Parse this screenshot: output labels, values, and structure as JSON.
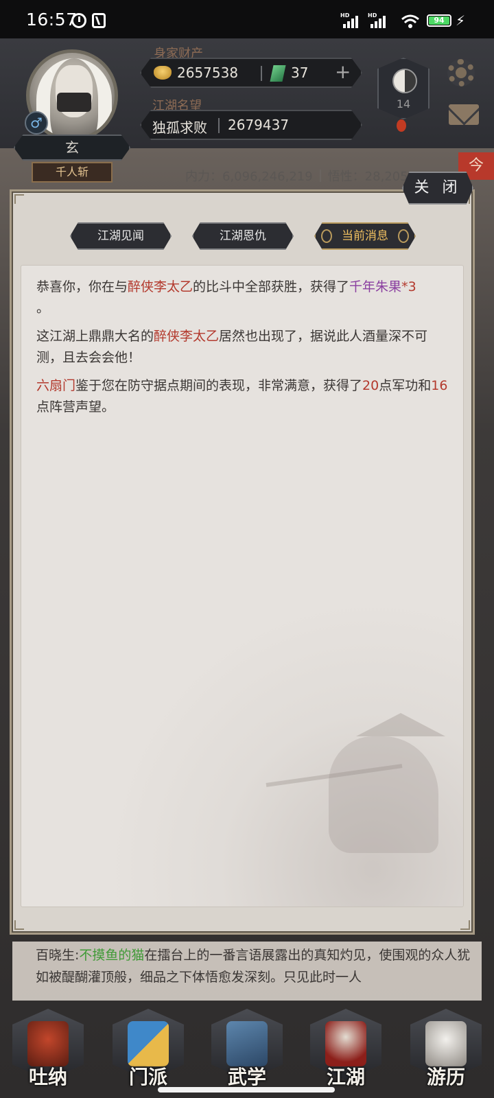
{
  "status_bar": {
    "time": "16:57",
    "hd1": "HD",
    "hd2": "HD",
    "battery": "94"
  },
  "header": {
    "wealth_label": "身家财产",
    "gold": "2657538",
    "jade": "37",
    "plus": "+",
    "fame_label": "江湖名望",
    "fame_title": "独孤求败",
    "fame_value": "2679437",
    "taiji_level": "14",
    "player_name": "玄",
    "player_title": "千人斩",
    "gender": "♂",
    "neili": "内力：6,096,246,219",
    "wuxing": "悟性：28,205,073",
    "red_tab": "今"
  },
  "modal": {
    "close_label": "关 闭",
    "tabs": [
      {
        "label": "江湖见闻"
      },
      {
        "label": "江湖恩仇"
      },
      {
        "label": "当前消息"
      }
    ],
    "active_tab": 2,
    "messages": {
      "m1": {
        "a": "恭喜你，你在与",
        "b": "醉侠李太乙",
        "c": "的比斗中全部获胜，获得了",
        "d": "千年朱果",
        "e": "*3",
        "f": "。"
      },
      "m2": {
        "a": "这江湖上鼎鼎大名的",
        "b": "醉侠李太乙",
        "c": "居然也出现了，据说此人酒量深不可测，且去会会他！"
      },
      "m3": {
        "a": "六扇门",
        "b": "鉴于您在防守据点期间的表现，非常满意，获得了",
        "c": "20",
        "d": "点军功和",
        "e": "16",
        "f": "点阵营声望。"
      }
    }
  },
  "ticker": {
    "a": "百晓生:",
    "b": "不摸鱼的猫",
    "c": "在擂台上的一番言语展露出的真知灼见，使围观的众人犹如被醍醐灌顶般，细品之下体悟愈发深刻。只见此时一人"
  },
  "nav": [
    {
      "label": "吐纳"
    },
    {
      "label": "门派"
    },
    {
      "label": "武学"
    },
    {
      "label": "江湖"
    },
    {
      "label": "游历"
    }
  ],
  "colors": {
    "highlight_red": "#b3392d",
    "highlight_purple": "#8a3fa0",
    "highlight_green": "#3f9a36",
    "active_tab_gold": "#f0c060"
  }
}
